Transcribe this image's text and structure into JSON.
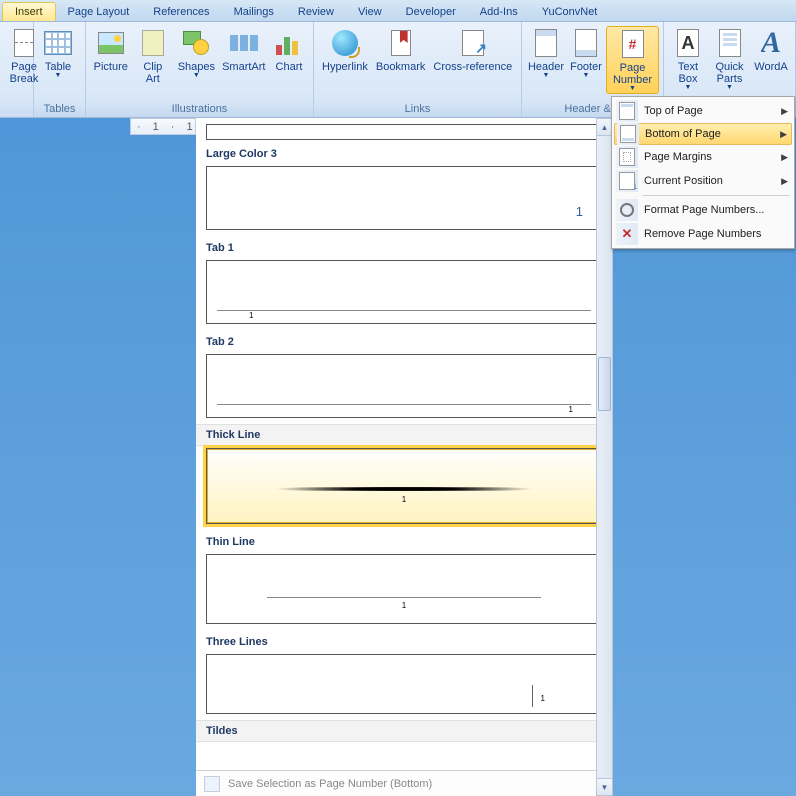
{
  "tabs": [
    "Insert",
    "Page Layout",
    "References",
    "Mailings",
    "Review",
    "View",
    "Developer",
    "Add-Ins",
    "YuConvNet"
  ],
  "active_tab": 0,
  "groups": {
    "g0_title": "",
    "g1_title": "Tables",
    "g2_title": "Illustrations",
    "g3_title": "Links",
    "g4_title": "Header & F",
    "g5_title": ""
  },
  "items": {
    "page_break": "Page Break",
    "table": "Table",
    "picture": "Picture",
    "clip_art": "Clip Art",
    "shapes": "Shapes",
    "smartart": "SmartArt",
    "chart": "Chart",
    "hyperlink": "Hyperlink",
    "bookmark": "Bookmark",
    "cross_ref": "Cross-reference",
    "header": "Header",
    "footer": "Footer",
    "page_number": "Page Number",
    "text_box": "Text Box",
    "quick_parts": "Quick Parts",
    "wordart": "WordA"
  },
  "menu": {
    "top": "Top of Page",
    "bottom": "Bottom of Page",
    "margins": "Page Margins",
    "current": "Current Position",
    "format": "Format Page Numbers...",
    "remove": "Remove Page Numbers"
  },
  "gallery": {
    "large_color_3": "Large Color 3",
    "lc3_num": "1",
    "tab1": "Tab 1",
    "tab1_num": "1",
    "tab2": "Tab 2",
    "tab2_num": "1",
    "thick": "Thick Line",
    "thick_num": "1",
    "thin": "Thin Line",
    "thin_num": "1",
    "three": "Three Lines",
    "three_num": "1",
    "tildes": "Tildes",
    "save": "Save Selection as Page Number (Bottom)"
  },
  "ruler": {
    "m1": "1",
    "m2": "1"
  }
}
